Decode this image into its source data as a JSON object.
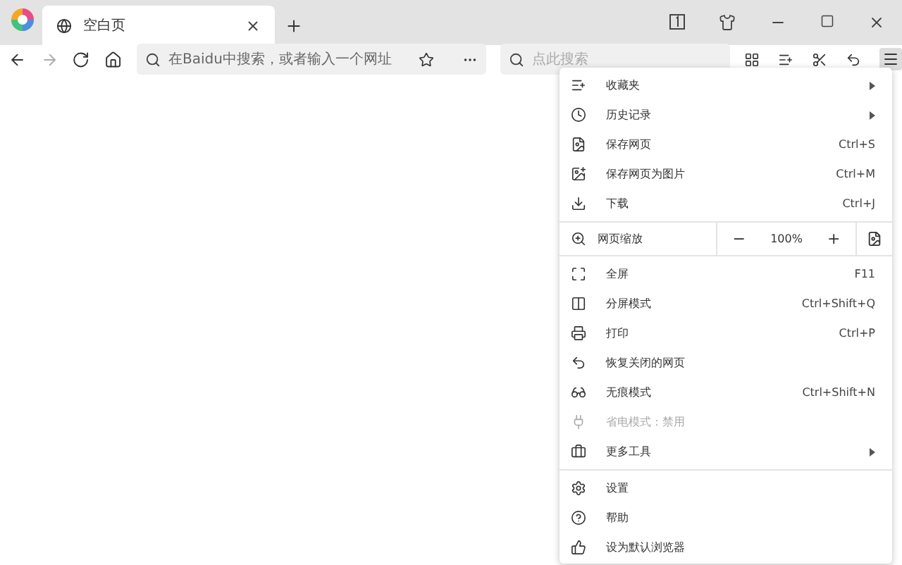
{
  "tabs": [
    {
      "label": "空白页",
      "selected": true
    }
  ],
  "toolbar": {
    "address_placeholder": "在Baidu中搜索，或者输入一个网址",
    "search_placeholder": "点此搜索"
  },
  "menu": {
    "sections": [
      {
        "items": [
          {
            "kind": "item",
            "label": "收藏夹",
            "submenu": true,
            "disabled": false
          },
          {
            "kind": "item",
            "label": "历史记录",
            "submenu": true,
            "disabled": false
          },
          {
            "kind": "item",
            "label": "保存网页",
            "shortcut": "Ctrl+S",
            "submenu": false,
            "disabled": false
          },
          {
            "kind": "item",
            "label": "保存网页为图片",
            "shortcut": "Ctrl+M",
            "submenu": false,
            "disabled": false
          },
          {
            "kind": "item",
            "label": "下载",
            "shortcut": "Ctrl+J",
            "submenu": false,
            "disabled": false
          }
        ]
      },
      {
        "items": [
          {
            "kind": "zoom",
            "label": "网页缩放",
            "minus": "−",
            "value": "100%",
            "plus": "+"
          }
        ]
      },
      {
        "items": [
          {
            "kind": "item",
            "label": "全屏",
            "shortcut": "F11",
            "submenu": false,
            "disabled": false
          },
          {
            "kind": "item",
            "label": "分屏模式",
            "shortcut": "Ctrl+Shift+Q",
            "submenu": false,
            "disabled": false
          },
          {
            "kind": "item",
            "label": "打印",
            "shortcut": "Ctrl+P",
            "submenu": false,
            "disabled": false
          },
          {
            "kind": "item",
            "label": "恢复关闭的网页",
            "submenu": false,
            "disabled": false
          },
          {
            "kind": "item",
            "label": "无痕模式",
            "shortcut": "Ctrl+Shift+N",
            "submenu": false,
            "disabled": false
          },
          {
            "kind": "item",
            "label": "省电模式：禁用",
            "submenu": false,
            "disabled": true
          },
          {
            "kind": "item",
            "label": "更多工具",
            "submenu": true,
            "disabled": false
          }
        ]
      },
      {
        "items": [
          {
            "kind": "item",
            "label": "设置",
            "submenu": false,
            "disabled": false
          },
          {
            "kind": "item",
            "label": "帮助",
            "submenu": false,
            "disabled": false
          },
          {
            "kind": "item",
            "label": "设为默认浏览器",
            "submenu": false,
            "disabled": false
          }
        ]
      }
    ]
  }
}
